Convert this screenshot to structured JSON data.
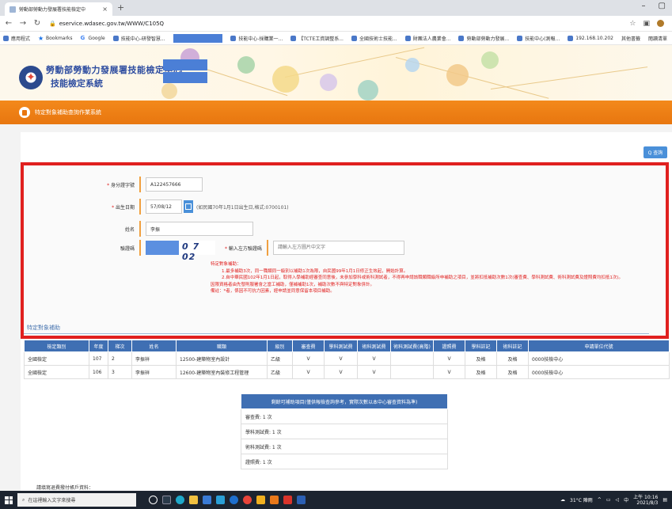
{
  "browser": {
    "tab_title": "勞動部勞動力發展署技能檢定中",
    "tab_close": "×",
    "new_tab": "+",
    "win_min": "–",
    "win_max": "▢",
    "url": "eservice.wdasec.gov.tw/WWW/C105Q",
    "bookmarks": [
      "應用程式",
      "Bookmarks",
      "Google",
      "技能中心-研發智慧...",
      "技能中心-採購業一...",
      "【TCTE工資調整系...",
      "全國技術士技能...",
      "財團法人農業會...",
      "勞動部勞動力發展...",
      "技能中心(測報...",
      "192.168.10.202"
    ],
    "bookmarks_right": [
      "其他書籤",
      "閱讀清單"
    ]
  },
  "header": {
    "title": "勞動部勞動力發展署技能檢定中心",
    "subtitle": "技能檢定系統",
    "system_name": "特定對象補助查詢作業系統"
  },
  "form": {
    "query_label": "Q 查詢",
    "id_label": "身分證字號",
    "id_value": "A122457666",
    "birth_label": "出生日期",
    "birth_value": "57/08/12",
    "birth_hint": "(如民國70年1月1日出生日,格式:0700101)",
    "name_label": "姓名",
    "name_value": "李振",
    "captcha_label": "驗證碼",
    "captcha_code": "0 7 02",
    "captcha_input_label": "輸入左方驗證碼",
    "captcha_placeholder": "請輸入左方圖片中文字",
    "required_mark": "*",
    "notes": [
      "特定對象補助：",
      "1.最多補助3次，同一職類同一級別以補助1次為限，自民國99年1月1日修正生效起，開始計算。",
      "2.自中華民國102年1月1日起，取得入學補助經審查同意後，未參加學科或術科測試者，不得再申請該職類職級所申補助之項目，並將扣抵補助次數1次(審查費、學科測試費、術科測試費及證照費均扣抵1次)。",
      "因限資格者由先發則服署會之當工補助，僅補補助1次，補助次數不與特定對象併計。",
      "備註：*者，係因不可抗力因素，經申請並同意保留本項目補助。"
    ]
  },
  "records": {
    "section_title": "特定對象補助",
    "columns": [
      "檢定類別",
      "年度",
      "梯次",
      "姓名",
      "職類",
      "級別",
      "審查費",
      "學科測試費",
      "術科測試費",
      "術科測試費(高階)",
      "證照費",
      "學科註記",
      "術科註記",
      "申請單位代號"
    ],
    "rows": [
      [
        "全國檢定",
        "107",
        "2",
        "李振祥",
        "12500-建築物室內設計",
        "乙級",
        "V",
        "V",
        "V",
        "",
        "V",
        "及格",
        "及格",
        "0000技檢中心"
      ],
      [
        "全國檢定",
        "106",
        "3",
        "李振祥",
        "12600-建築物室內裝修工程管理",
        "乙級",
        "V",
        "V",
        "V",
        "",
        "V",
        "及格",
        "及格",
        "0000技檢中心"
      ]
    ]
  },
  "remaining": {
    "header": "剩餘可補助項目(僅供報檢查詢參考，實際次數以本中心審查資料為準)",
    "items": [
      "審查費: 1 次",
      "學科測試費: 1 次",
      "術科測試費: 1 次",
      "證照費: 1 次"
    ]
  },
  "footer_note": "請填寫退費撥付帳戶資料：",
  "taskbar": {
    "search_placeholder": "在這裡輸入文字來搜尋",
    "weather": "31°C 陣雨",
    "ime": "中",
    "time_line1": "上午 10:16",
    "time_line2": "2021/8/3"
  },
  "colors": {
    "accent_orange": "#e8760f",
    "table_header_blue": "#3f6fb3",
    "highlight_red": "#e0201f"
  }
}
